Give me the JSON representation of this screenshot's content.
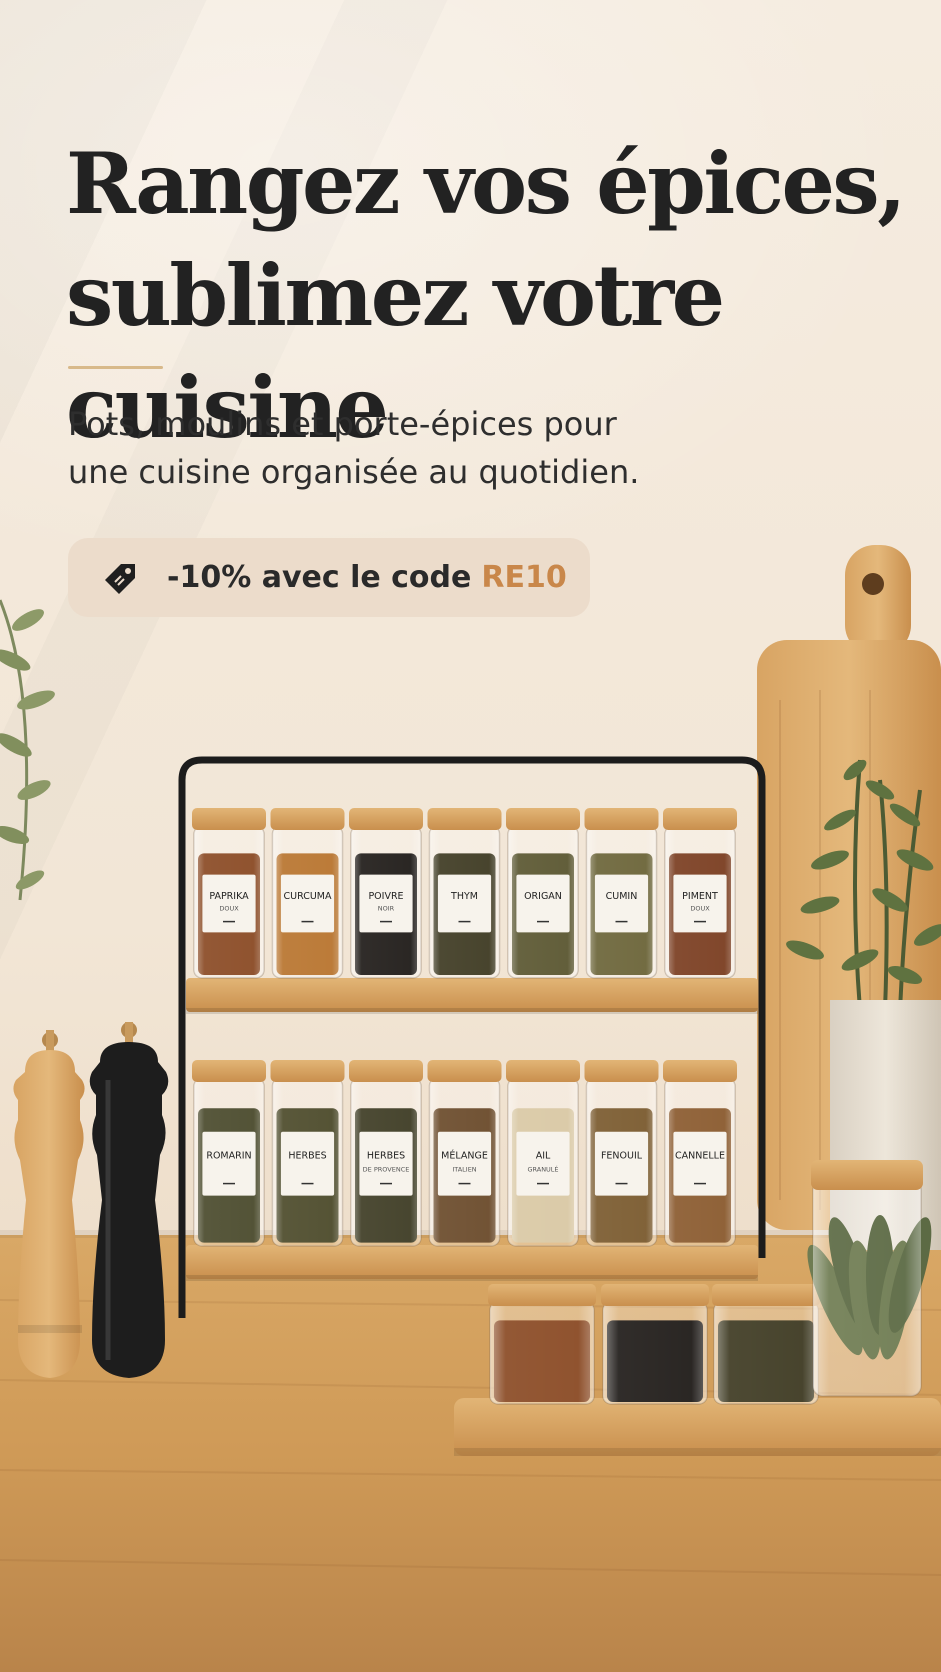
{
  "headline": {
    "line1": "Rangez vos épices,",
    "line2": "sublimez votre cuisine"
  },
  "subtitle": {
    "line1": "Pots, moulins et porte-épices pour",
    "line2": "une cuisine organisée au quotidien."
  },
  "promo": {
    "icon": "price-tag-icon",
    "text": "-10% avec le code",
    "code": "RE10",
    "code_color": "#c9874a"
  },
  "rack": {
    "top_row": [
      {
        "name": "PAPRIKA",
        "sub": "DOUX"
      },
      {
        "name": "CURCUMA",
        "sub": ""
      },
      {
        "name": "POIVRE",
        "sub": "NOIR"
      },
      {
        "name": "THYM",
        "sub": ""
      },
      {
        "name": "ORIGAN",
        "sub": ""
      },
      {
        "name": "CUMIN",
        "sub": ""
      },
      {
        "name": "PIMENT",
        "sub": "DOUX"
      }
    ],
    "bottom_row": [
      {
        "name": "ROMARIN",
        "sub": ""
      },
      {
        "name": "HERBES",
        "sub": ""
      },
      {
        "name": "HERBES",
        "sub": "DE PROVENCE"
      },
      {
        "name": "MÉLANGE",
        "sub": "ITALIEN"
      },
      {
        "name": "AIL",
        "sub": "GRANULÉ"
      },
      {
        "name": "FENOUIL",
        "sub": ""
      },
      {
        "name": "CANNELLE",
        "sub": ""
      }
    ]
  },
  "colors": {
    "wall": "#f4eadc",
    "wood": "#d9a866",
    "rack_frame": "#1c1c1c",
    "headline": "#222222"
  }
}
